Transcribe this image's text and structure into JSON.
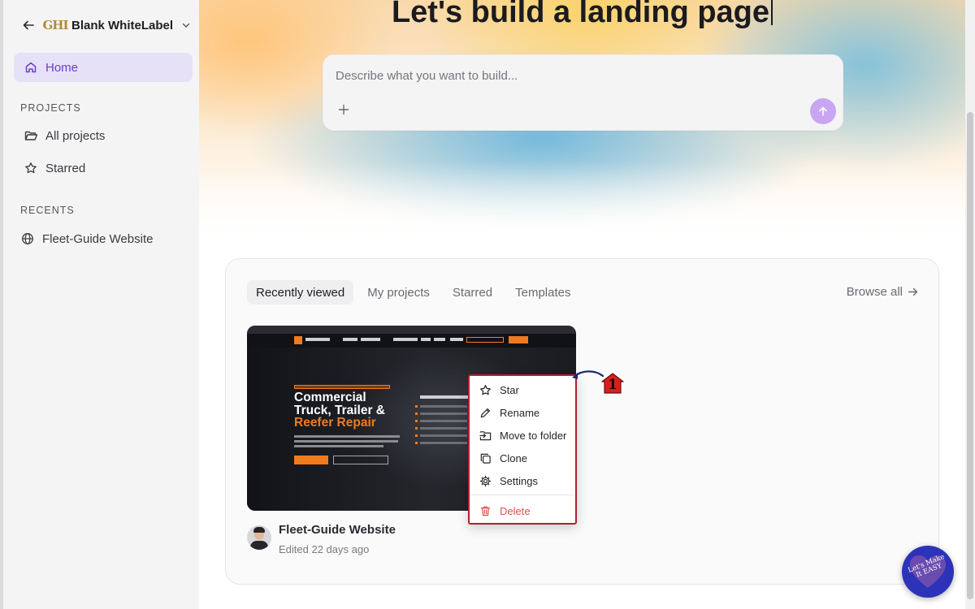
{
  "sidebar": {
    "workspace_name": "Blank WhiteLabel",
    "workspace_logo_text": "GHI",
    "home_label": "Home",
    "projects_heading": "PROJECTS",
    "all_projects_label": "All projects",
    "starred_label": "Starred",
    "recents_heading": "RECENTS",
    "recent_items": [
      {
        "label": "Fleet-Guide Website",
        "icon": "globe-icon"
      }
    ]
  },
  "hero": {
    "title": "Let's build a landing page",
    "prompt_placeholder": "Describe what you want to build..."
  },
  "projects_panel": {
    "tabs": [
      {
        "label": "Recently viewed",
        "active": true
      },
      {
        "label": "My projects",
        "active": false
      },
      {
        "label": "Starred",
        "active": false
      },
      {
        "label": "Templates",
        "active": false
      }
    ],
    "browse_all_label": "Browse all",
    "project": {
      "name": "Fleet-Guide Website",
      "meta": "Edited 22 days ago",
      "thumbnail": {
        "heading_line1": "Commercial",
        "heading_line2": "Truck, Trailer &",
        "heading_line3": "Reefer Repair"
      }
    }
  },
  "context_menu": {
    "items": [
      {
        "label": "Star",
        "icon": "star-icon"
      },
      {
        "label": "Rename",
        "icon": "pencil-icon"
      },
      {
        "label": "Move to folder",
        "icon": "move-to-folder-icon"
      },
      {
        "label": "Clone",
        "icon": "clone-icon"
      },
      {
        "label": "Settings",
        "icon": "gear-icon"
      }
    ],
    "delete_label": "Delete",
    "delete_color": "#d9534f"
  },
  "annotation": {
    "step_number": "1",
    "highlight_color": "#b0222e"
  },
  "badge": {
    "text": "Let's Make It EASY"
  },
  "colors": {
    "accent": "#6b3fc7",
    "home_bg": "#e7e1f7",
    "send_button": "#c8a6f2"
  }
}
